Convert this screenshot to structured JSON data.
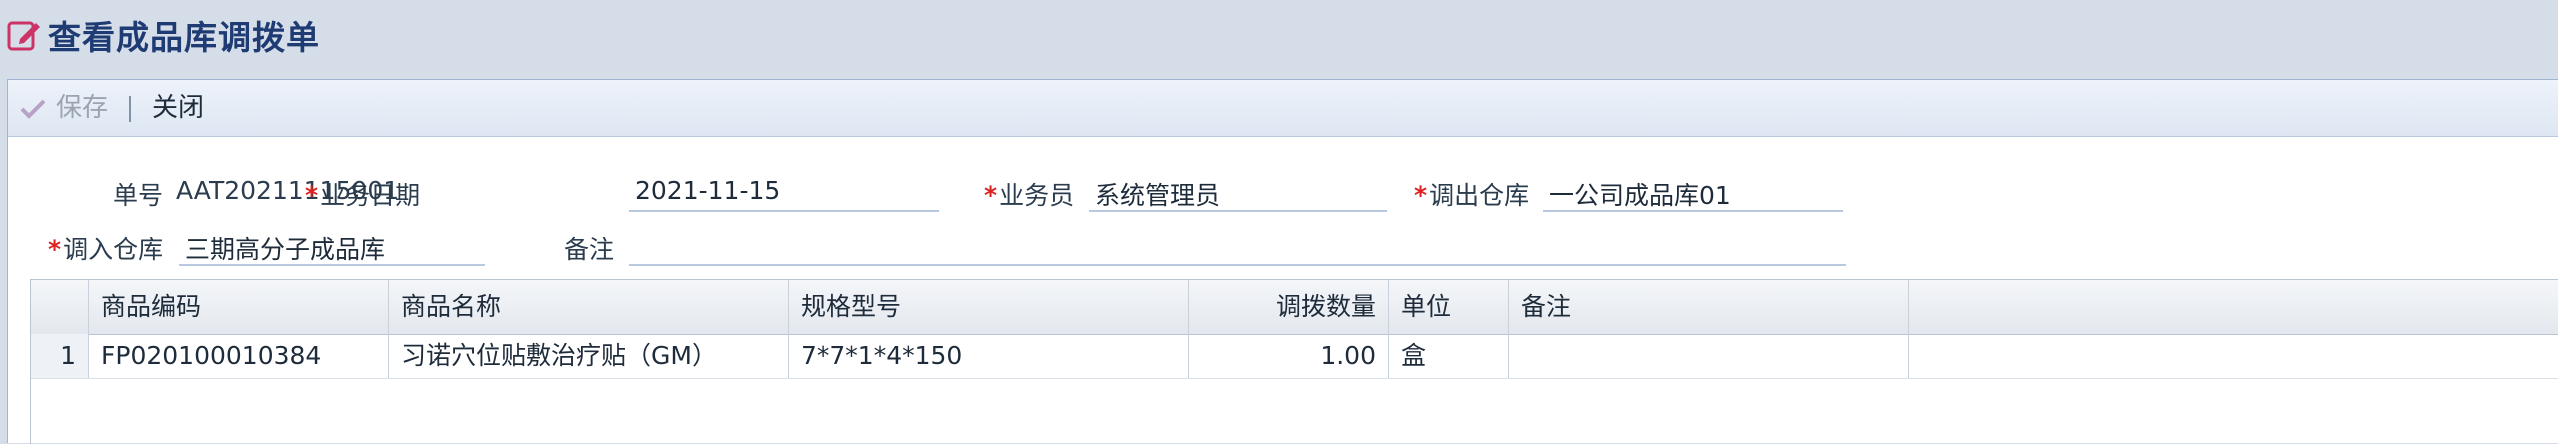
{
  "window": {
    "title": "查看成品库调拨单",
    "title_icon": "edit-icon"
  },
  "toolbar": {
    "save_label": "保存",
    "close_label": "关闭"
  },
  "form": {
    "order_no_label": "单号",
    "order_no": "AAT20211115001",
    "date_label": "业务日期",
    "date": "2021-11-15",
    "staff_label": "业务员",
    "staff": "系统管理员",
    "out_wh_label": "调出仓库",
    "out_wh": "一公司成品库01",
    "in_wh_label": "调入仓库",
    "in_wh": "三期高分子成品库",
    "remark_label": "备注",
    "remark": "",
    "required_mark": "*"
  },
  "grid": {
    "columns": [
      "商品编码",
      "商品名称",
      "规格型号",
      "调拨数量",
      "单位",
      "备注"
    ],
    "rows": [
      {
        "index": "1",
        "code": "FP020100010384",
        "name": "习诺穴位贴敷治疗贴（GM）",
        "spec": "7*7*1*4*150",
        "qty": "1.00",
        "unit": "盒",
        "remark": ""
      }
    ]
  },
  "colors": {
    "title": "#1f3b73",
    "required": "#dd2222",
    "accent_icon": "#cc3366"
  }
}
